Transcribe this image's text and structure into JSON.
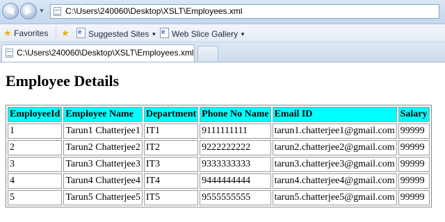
{
  "browser": {
    "address_url": "C:\\Users\\240060\\Desktop\\XSLT\\Employees.xml",
    "favorites_label": "Favorites",
    "suggested_sites_label": "Suggested Sites",
    "web_slice_gallery_label": "Web Slice Gallery",
    "tab_title": "C:\\Users\\240060\\Desktop\\XSLT\\Employees.xml"
  },
  "page": {
    "title": "Employee Details"
  },
  "table": {
    "headers": [
      "EmployeeId",
      "Employee Name",
      "Department",
      "Phone No Name",
      "Email ID",
      "Salary"
    ],
    "rows": [
      [
        "1",
        "Tarun1 Chatterjee1",
        "IT1",
        "9111111111",
        "tarun1.chatterjee1@gmail.com",
        "99999"
      ],
      [
        "2",
        "Tarun2 Chatterjee2",
        "IT2",
        "9222222222",
        "tarun2.chatterjee2@gmail.com",
        "99999"
      ],
      [
        "3",
        "Tarun3 Chatterjee3",
        "IT3",
        "9333333333",
        "tarun3.chatterjee3@gmail.com",
        "99999"
      ],
      [
        "4",
        "Tarun4 Chatterjee4",
        "IT4",
        "9444444444",
        "tarun4.chatterjee4@gmail.com",
        "99999"
      ],
      [
        "5",
        "Tarun5 Chatterjee5",
        "IT5",
        "9555555555",
        "tarun5.chatterjee5@gmail.com",
        "99999"
      ]
    ]
  },
  "colors": {
    "header_background": "#00ffff"
  }
}
